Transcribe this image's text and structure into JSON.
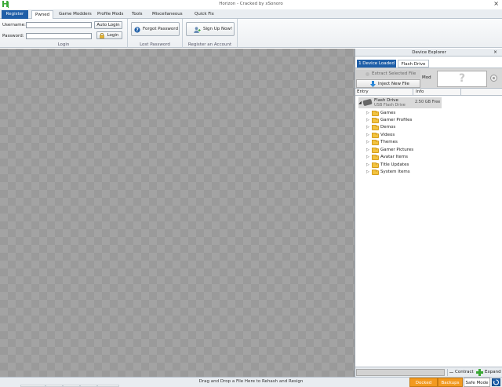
{
  "window": {
    "logo": "H",
    "title": "Horizon - Cracked by xSonoro",
    "close": "×"
  },
  "menu": {
    "tabs": [
      {
        "label": "Register"
      },
      {
        "label": "Pwned"
      },
      {
        "label": "Game Modders"
      },
      {
        "label": "Profile Mods"
      },
      {
        "label": "Tools"
      },
      {
        "label": "Miscellaneous"
      },
      {
        "label": "Quick Fix"
      }
    ]
  },
  "ribbon": {
    "login": {
      "username_label": "Username:",
      "password_label": "Password:",
      "username_value": "",
      "password_value": "",
      "auto_login": "Auto Login",
      "login": "Login",
      "group_label": "Login"
    },
    "lost_password": {
      "button": "Forgot Password",
      "group_label": "Lost Password"
    },
    "register": {
      "button": "Sign Up Now!",
      "group_label": "Register an Account"
    }
  },
  "device_explorer": {
    "title": "Device Explorer",
    "close": "×",
    "tabs": [
      "1 Device Loaded",
      "Flash Drive"
    ],
    "extract": "Extract Selected File",
    "inject": "Inject New File",
    "mod_label": "Mod",
    "preview": "?",
    "columns": [
      "Entry",
      "Info"
    ],
    "drive": {
      "name": "Flash Drive",
      "type": "USB Flash Drive",
      "free": "2.50 GB Free"
    },
    "folders": [
      "Games",
      "Gamer Profiles",
      "Demos",
      "Videos",
      "Themes",
      "Gamer Pictures",
      "Avatar Items",
      "Title Updates",
      "System Items"
    ],
    "contract": "Contract",
    "expand": "Expand"
  },
  "status": {
    "message": "Drag and Drop a File Here to Rehash and Resign",
    "docked": "Docked",
    "backups": "Backups",
    "safe_mode": "Safe Mode"
  }
}
